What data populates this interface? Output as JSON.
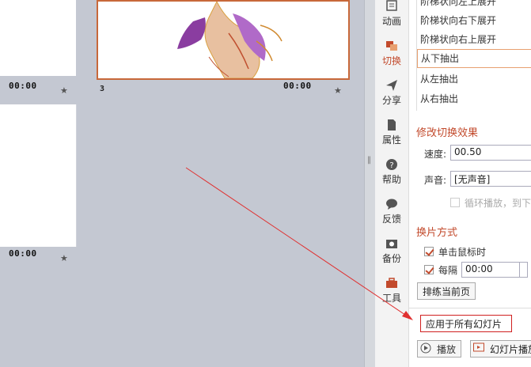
{
  "slides": {
    "times": [
      "00:00",
      "00:00",
      "00:00"
    ],
    "slide3_number": "3"
  },
  "sidebar": {
    "items": [
      {
        "label": "动画",
        "icon": "animation-icon"
      },
      {
        "label": "切换",
        "icon": "transition-icon"
      },
      {
        "label": "分享",
        "icon": "share-icon"
      },
      {
        "label": "属性",
        "icon": "properties-icon"
      },
      {
        "label": "帮助",
        "icon": "help-icon"
      },
      {
        "label": "反馈",
        "icon": "feedback-icon"
      },
      {
        "label": "备份",
        "icon": "backup-icon"
      },
      {
        "label": "工具",
        "icon": "tools-icon"
      }
    ],
    "active_index": 1
  },
  "panel": {
    "effects": [
      "阶梯状向左上展开",
      "阶梯状向右下展开",
      "阶梯状向右上展开",
      "从下抽出",
      "从左抽出",
      "从右抽出"
    ],
    "selected_effect": "从下抽出",
    "modify_title": "修改切换效果",
    "speed_label": "速度:",
    "speed_value": "00.50",
    "sound_label": "声音:",
    "sound_value": "[无声音]",
    "loop_label": "循环播放，到下",
    "advance_title": "换片方式",
    "on_click_label": "单击鼠标时",
    "every_label": "每隔",
    "every_value": "00:00",
    "rehearse_button": "排练当前页",
    "apply_all_button": "应用于所有幻灯片",
    "play_button": "播放",
    "slideshow_button": "幻灯片播放"
  },
  "colors": {
    "accent": "#c24a2c",
    "annotation": "#e03030"
  }
}
